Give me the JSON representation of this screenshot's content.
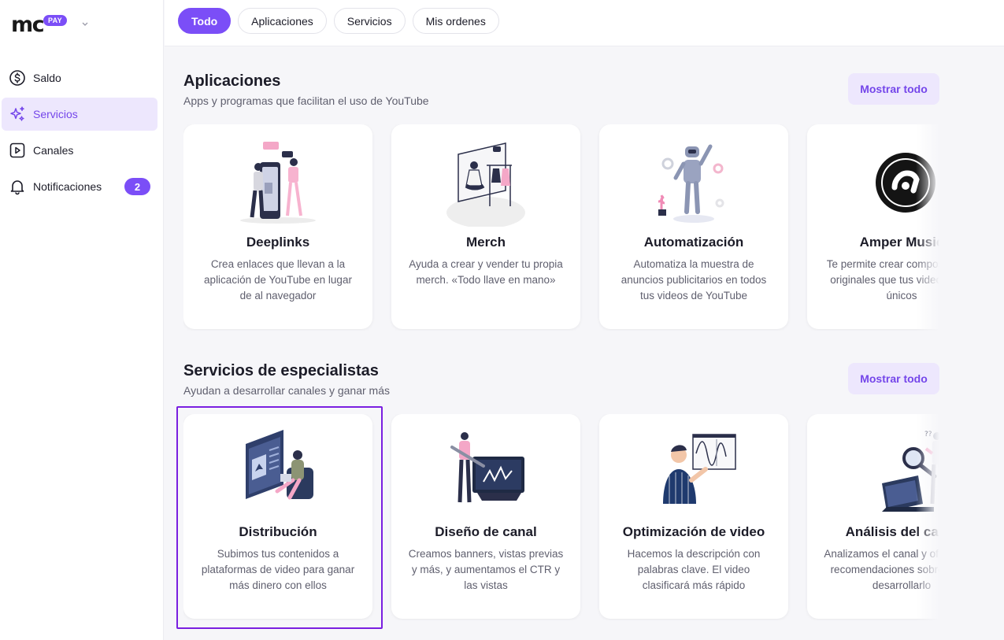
{
  "brand": {
    "logo_text": "mc",
    "logo_badge": "PAY"
  },
  "sidebar": {
    "items": [
      {
        "label": "Saldo",
        "icon": "dollar-circle-icon",
        "active": false
      },
      {
        "label": "Servicios",
        "icon": "sparkles-icon",
        "active": true
      },
      {
        "label": "Canales",
        "icon": "play-square-icon",
        "active": false
      },
      {
        "label": "Notificaciones",
        "icon": "bell-icon",
        "active": false,
        "badge": "2"
      }
    ]
  },
  "tabs": [
    {
      "label": "Todo",
      "active": true
    },
    {
      "label": "Aplicaciones",
      "active": false
    },
    {
      "label": "Servicios",
      "active": false
    },
    {
      "label": "Mis ordenes",
      "active": false
    }
  ],
  "sections": [
    {
      "title": "Aplicaciones",
      "subtitle": "Apps y programas que facilitan el uso de YouTube",
      "show_all": "Mostrar todo",
      "cards": [
        {
          "title": "Deeplinks",
          "description": "Crea enlaces que llevan a la aplicación de YouTube en lugar de al navegador",
          "illustration": "people-phone-illustration"
        },
        {
          "title": "Merch",
          "description": "Ayuda a crear y vender tu propia merch. «Todo llave en mano»",
          "illustration": "clothing-rack-illustration"
        },
        {
          "title": "Automatización",
          "description": "Automatiza la muestra de anuncios publicitarios en todos tus videos de YouTube",
          "illustration": "robot-illustration"
        },
        {
          "title": "Amper Music",
          "description": "Te permite crear composiciones originales que tus videos sean únicos",
          "illustration": "amper-logo"
        }
      ]
    },
    {
      "title": "Servicios de especialistas",
      "subtitle": "Ayudan a desarrollar canales y ganar más",
      "show_all": "Mostrar todo",
      "cards": [
        {
          "title": "Distribución",
          "description": "Subimos tus contenidos a plataformas de video para ganar más dinero con ellos",
          "illustration": "upload-screen-illustration"
        },
        {
          "title": "Diseño de canal",
          "description": "Creamos banners, vistas previas y más, y aumentamos el CTR y las vistas",
          "illustration": "designer-tablet-illustration"
        },
        {
          "title": "Optimización de video",
          "description": "Hacemos la descripción con palabras clave. El video clasificará más rápido",
          "illustration": "presenter-chart-illustration"
        },
        {
          "title": "Análisis del canal",
          "description": "Analizamos el canal y ofrecemos recomendaciones sobre como desarrollarlo",
          "illustration": "magnifier-laptop-illustration"
        }
      ]
    }
  ],
  "colors": {
    "accent": "#7b4ef7",
    "accent_light": "#ede7fd",
    "highlight_border": "#7a1fe0"
  }
}
